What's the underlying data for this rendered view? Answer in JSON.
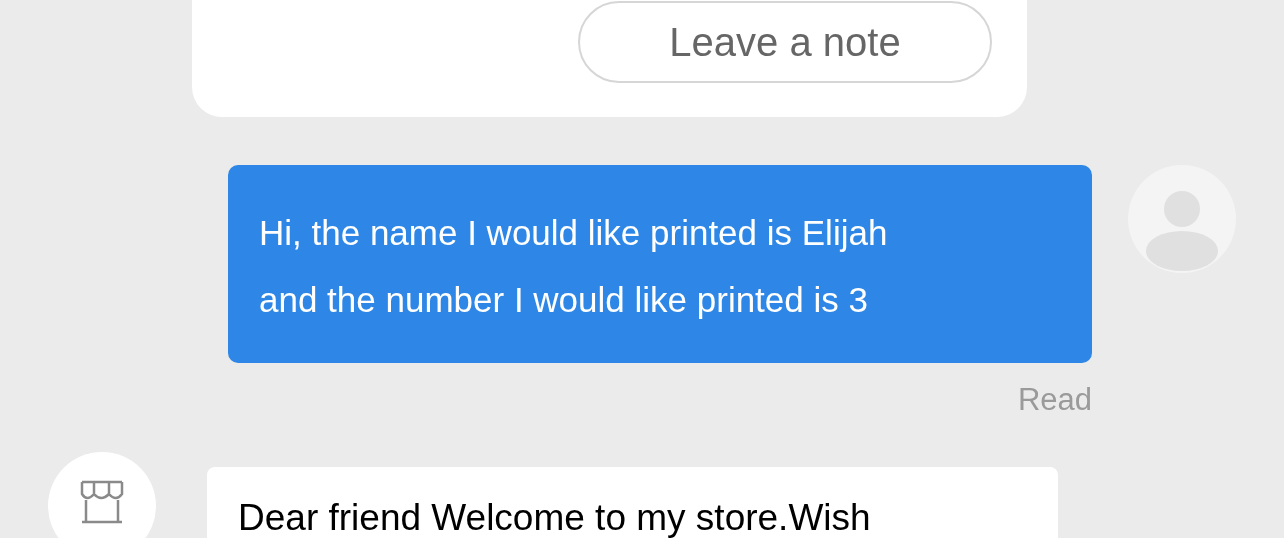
{
  "note_card": {
    "button": "Leave a note"
  },
  "messages": [
    {
      "kind": "outgoing",
      "text": "Hi, the name I would like printed is Elijah and the number I would like printed is 3",
      "status": "Read"
    },
    {
      "kind": "incoming",
      "text": "Dear friend Welcome to my store.Wish"
    }
  ]
}
